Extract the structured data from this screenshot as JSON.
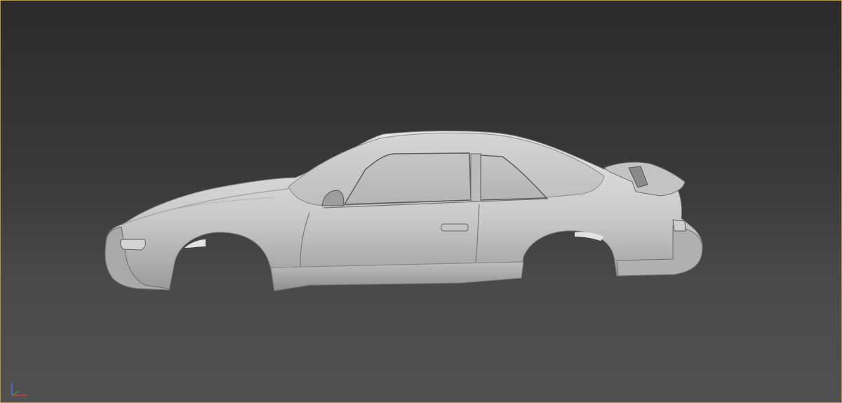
{
  "viewport": {
    "border_color": "#b8953a",
    "background_top": "#2b2b2b",
    "background_bottom": "#515151"
  },
  "model": {
    "type": "car-body-shell",
    "shading": "grey-clay",
    "base_color": "#c8c8c8",
    "highlight_color": "#e4e4e4",
    "shadow_color": "#8a8a8a"
  },
  "gizmo": {
    "axes": [
      {
        "name": "x",
        "color": "#d23a3a"
      },
      {
        "name": "y",
        "color": "#3a9a3a"
      },
      {
        "name": "z",
        "color": "#4a6adc"
      }
    ]
  }
}
